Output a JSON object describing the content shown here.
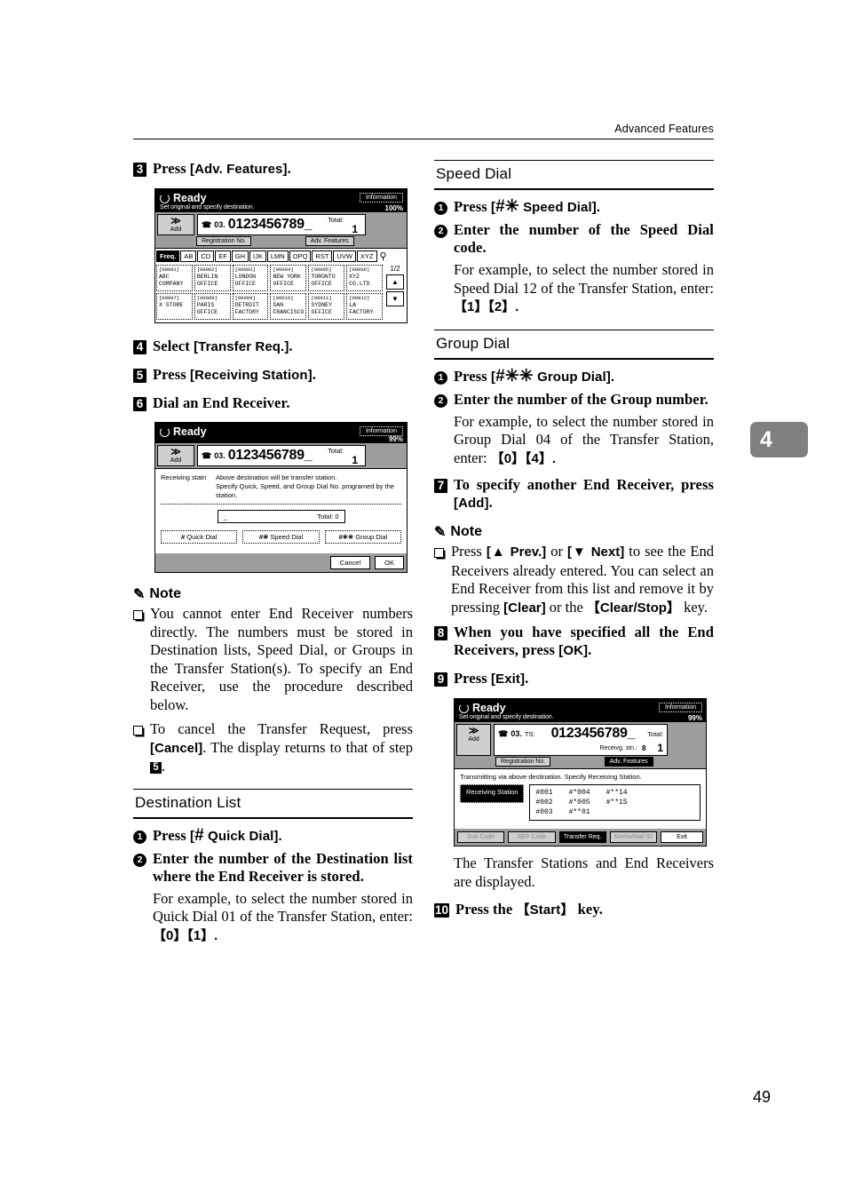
{
  "header": {
    "title": "Advanced Features"
  },
  "chapter_tab": {
    "number": "4"
  },
  "page_number": "49",
  "left_column": {
    "step3": {
      "num": "3",
      "text_prefix": "Press ",
      "text_bracket": "[Adv. Features]",
      "text_suffix": "."
    },
    "screen1": {
      "status": "Ready",
      "subtitle": "Set original and specify destination.",
      "information_button": "Information",
      "memory": "100%",
      "add_button": "Add",
      "add_arrows": "≫",
      "phone_prefix": "03.",
      "number": "0123456789_",
      "total_label": "Total:",
      "total_value": "1",
      "tab_registration": "Registration No.",
      "tab_adv_features": "Adv. Features",
      "alpha_tabs": [
        "Freq.",
        "AB",
        "CD",
        "EF",
        "GH",
        "IJK",
        "LMN",
        "OPQ",
        "RST",
        "UVW",
        "XYZ"
      ],
      "alpha_selected": "Freq.",
      "search_icon": "search-icon",
      "page_indicator": "1/2",
      "destinations": [
        {
          "id": "[00001]",
          "name": "ABC COMPANY"
        },
        {
          "id": "[00002]",
          "name": "BERLIN OFFICE"
        },
        {
          "id": "[00003]",
          "name": "LONDON OFFICE"
        },
        {
          "id": "[00004]",
          "name": "NEW YORK OFFICE"
        },
        {
          "id": "[00005]",
          "name": "TORONTO OFFICE"
        },
        {
          "id": "[00006]",
          "name": "XYZ CO.LTD"
        },
        {
          "id": "[00007]",
          "name": "X STORE"
        },
        {
          "id": "[00008]",
          "name": "PARIS OFFICE"
        },
        {
          "id": "[00009]",
          "name": "DETROIT FACTORY"
        },
        {
          "id": "[00010]",
          "name": "SAN FRANCISCO"
        },
        {
          "id": "[00011]",
          "name": "SYDNEY OFFICE"
        },
        {
          "id": "[00012]",
          "name": "LA FACTORY"
        }
      ]
    },
    "step4": {
      "num": "4",
      "text_prefix": "Select ",
      "text_bracket": "[Transfer Req.]",
      "text_suffix": "."
    },
    "step5": {
      "num": "5",
      "text_prefix": "Press ",
      "text_bracket": "[Receiving Station]",
      "text_suffix": "."
    },
    "step6": {
      "num": "6",
      "text": "Dial an End Receiver."
    },
    "screen2": {
      "status": "Ready",
      "information_button": "Information",
      "memory": "99%",
      "add_button": "Add",
      "add_arrows": "≫",
      "phone_prefix": "03.",
      "number": "0123456789_",
      "total_label": "Total:",
      "total_value": "1",
      "dialog_label": "Receiving statn",
      "dialog_line1": "Above destination will be transfer station.",
      "dialog_line2": "Specify Quick, Speed, and Group Dial No. programed by the station.",
      "entry_cursor": "_",
      "entry_total_label": "Total:",
      "entry_total_value": "0",
      "btn_quick_dial": "Quick Dial",
      "btn_quick_dial_sym": "#",
      "btn_speed_dial": "Speed Dial",
      "btn_speed_dial_sym": "#✳",
      "btn_group_dial": "Group Dial",
      "btn_group_dial_sym": "#✳✳",
      "btn_cancel": "Cancel",
      "btn_ok": "OK"
    },
    "note1": {
      "heading": "Note",
      "icon": "pencil-icon",
      "items": [
        "You cannot enter End Receiver numbers directly. The numbers must be stored in Destination lists, Speed Dial, or Groups in the Transfer Station(s). To specify an End Receiver, use the procedure described below.",
        "To cancel the Transfer Request, press [Cancel]. The display returns to that of step 5."
      ],
      "item2_pre": "To cancel the Transfer Request, press ",
      "item2_bold": "[Cancel]",
      "item2_mid": ". The display returns to that of step ",
      "item2_num": "5",
      "item2_end": "."
    },
    "destination_list_section": {
      "heading": "Destination List",
      "sub1_num": "❶",
      "sub1_pre": "Press ",
      "sub1_bracket_open": "[",
      "sub1_sym": "#",
      "sub1_label": " Quick Dial",
      "sub1_bracket_close": "].",
      "sub2_num": "❷",
      "sub2_text": "Enter the number of the Destination list where the End Receiver is stored.",
      "example": "For example, to select the number stored in Quick Dial 01 of the Transfer Station, enter:",
      "example_keys": "【0】【1】."
    }
  },
  "right_column": {
    "speed_dial_section": {
      "heading": "Speed Dial",
      "sub1_num": "❶",
      "sub1_pre": "Press ",
      "sub1_bracket_open": "[",
      "sub1_sym": "#✳",
      "sub1_label": " Speed Dial",
      "sub1_bracket_close": "].",
      "sub2_num": "❷",
      "sub2_text": "Enter the number of the Speed Dial code.",
      "example": "For example, to select the number stored in Speed Dial 12 of the Transfer Station, enter:",
      "example_keys": "【1】【2】."
    },
    "group_dial_section": {
      "heading": "Group Dial",
      "sub1_num": "❶",
      "sub1_pre": "Press ",
      "sub1_bracket_open": "[",
      "sub1_sym": "#✳✳",
      "sub1_label": " Group Dial",
      "sub1_bracket_close": "].",
      "sub2_num": "❷",
      "sub2_text": "Enter the number of the Group number.",
      "example": "For example, to select the number stored in Group Dial 04 of the Transfer Station, enter:",
      "example_keys": "【0】【4】."
    },
    "step7": {
      "num": "7",
      "text_pre": "To specify another End Receiver, press ",
      "text_bracket": "[Add]",
      "text_end": "."
    },
    "note2": {
      "heading": "Note",
      "icon": "pencil-icon",
      "item_pre": "Press ",
      "item_b1": "[▲ Prev.]",
      "item_mid1": " or ",
      "item_b2": "[▼ Next]",
      "item_mid2": " to see the End Receivers already entered. You can select an End Receiver from this list and remove it by pressing ",
      "item_b3": "[Clear]",
      "item_mid3": " or the ",
      "item_b4": "【Clear/Stop】",
      "item_end": " key."
    },
    "step8": {
      "num": "8",
      "text_pre": "When you have specified all the End Receivers, press ",
      "text_bracket": "[OK]",
      "text_end": "."
    },
    "step9": {
      "num": "9",
      "text_pre": "Press ",
      "text_bracket": "[Exit]",
      "text_end": "."
    },
    "screen3": {
      "status": "Ready",
      "subtitle": "Set original and specify destination.",
      "information_button": "Information",
      "memory": "99%",
      "add_button": "Add",
      "add_arrows": "≫",
      "phone_prefix": "03.",
      "ts_label": "TS:",
      "number": "0123456789_",
      "total_label": "Total:",
      "total_value": "1",
      "recvg_label": "Receivg. stn.:",
      "recvg_value": "8",
      "tab_registration": "Registration No.",
      "tab_adv_features": "Adv. Features",
      "body_note": "Transmitting via above destination.  Specify Receiving Station.",
      "receiving_station_button": "Receiving Station",
      "list_col1": [
        "#001",
        "#002",
        "#003"
      ],
      "list_col2": [
        "#*004",
        "#*005",
        "#**01"
      ],
      "list_col3": [
        "#**14",
        "#**15"
      ],
      "footer_buttons": [
        "Sub Code",
        "SEP Code",
        "Transfer Req.",
        "Memo/Mail ID",
        "Exit"
      ],
      "footer_selected": "Transfer Req."
    },
    "caption": "The Transfer Stations and End Receivers are displayed.",
    "step10": {
      "num": "10",
      "text_pre": "Press the ",
      "text_bracket": "【Start】",
      "text_end": " key."
    }
  }
}
